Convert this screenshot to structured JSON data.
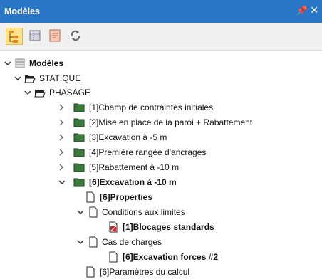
{
  "window": {
    "title": "Modèles"
  },
  "toolbar": {
    "buttons": [
      "tree-view",
      "layer-view",
      "document-view",
      "refresh"
    ]
  },
  "tree": {
    "root": "Modèles",
    "statique": "STATIQUE",
    "phasage": "PHASAGE",
    "phases": [
      "[1]Champ de contraintes initiales",
      "[2]Mise en place de la paroi + Rabattement",
      "[3]Excavation à -5 m",
      "[4]Première rangée d'ancrages",
      "[5]Rabattement à -10 m",
      "[6]Excavation à -10 m"
    ],
    "properties": "[6]Properties",
    "conditions": "Conditions aux limites",
    "blocages": "[1]Blocages standards",
    "cas_charges": "Cas de charges",
    "excavation_forces": "[6]Excavation forces #2",
    "parametres": "[6]Paramètres du calcul"
  },
  "colors": {
    "titlebar": "#2a76c6",
    "folder": "#3a7a3a"
  }
}
